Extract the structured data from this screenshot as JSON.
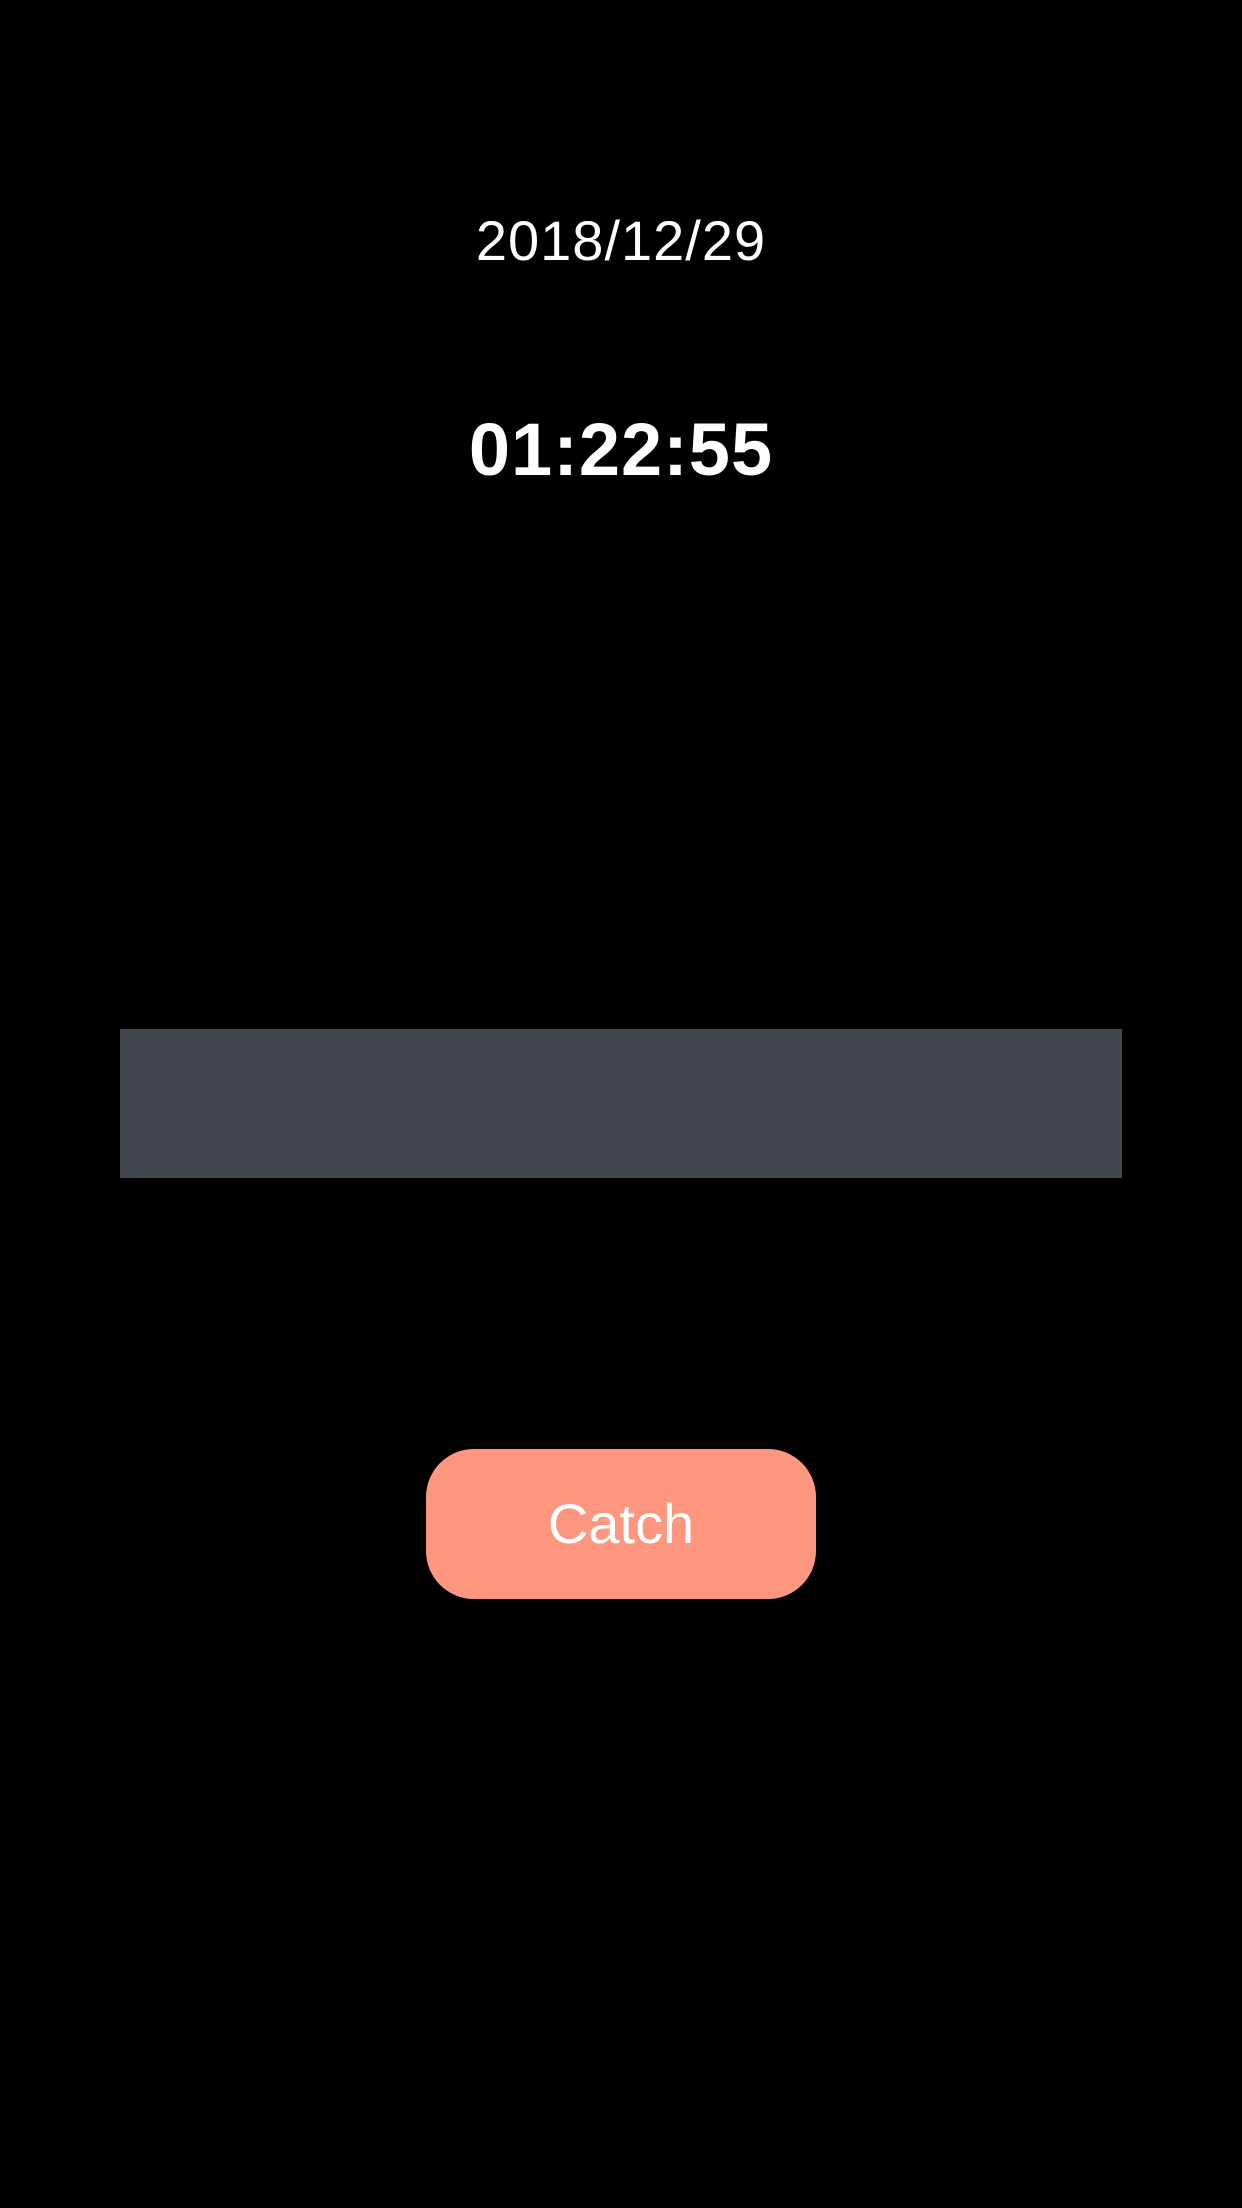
{
  "header": {
    "date": "2018/12/29",
    "time": "01:22:55"
  },
  "status_bar": {
    "text": ""
  },
  "actions": {
    "catch_label": "Catch"
  },
  "colors": {
    "background": "#000000",
    "status_bar": "#41464e",
    "button": "#ff9680",
    "text": "#ffffff"
  }
}
